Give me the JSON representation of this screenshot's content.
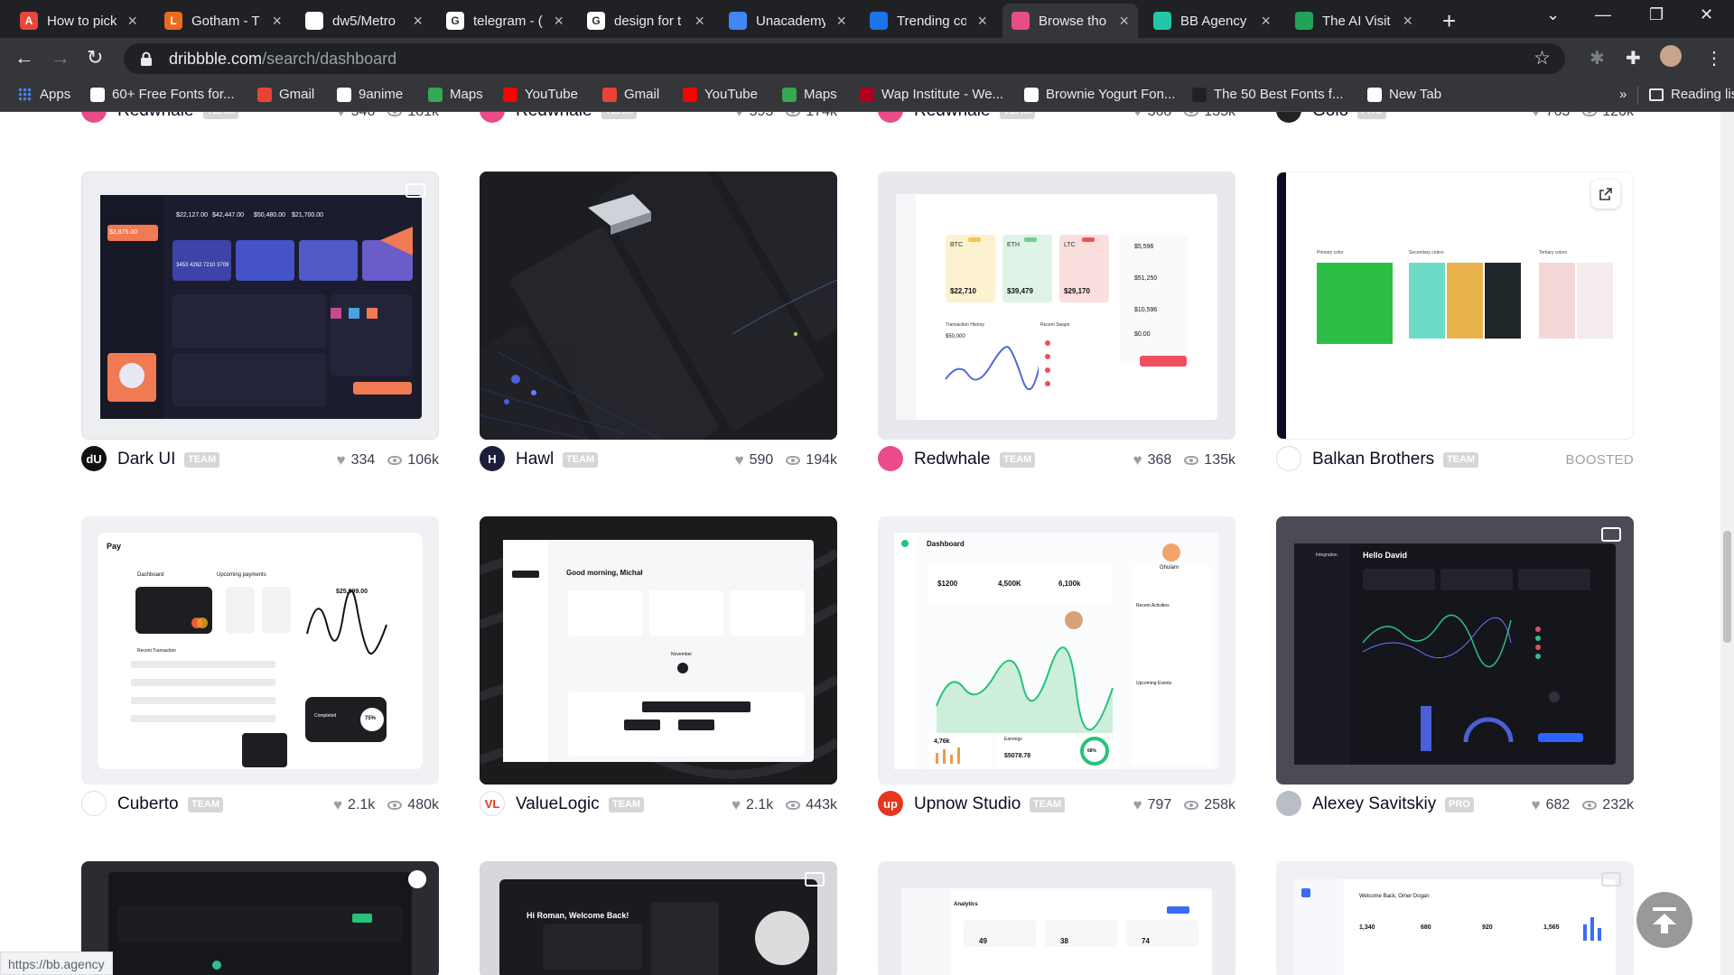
{
  "browser": {
    "tabs": [
      {
        "title": "How to pick",
        "color": "#e8453c",
        "letter": "A",
        "active": false
      },
      {
        "title": "Gotham - T",
        "color": "#e86b1f",
        "letter": "L",
        "active": false
      },
      {
        "title": "dw5/Metro",
        "color": "#ffffff",
        "letter": "",
        "active": false
      },
      {
        "title": "telegram - (",
        "color": "#ffffff",
        "letter": "G",
        "active": false
      },
      {
        "title": "design for t",
        "color": "#ffffff",
        "letter": "G",
        "active": false
      },
      {
        "title": "Unacademy",
        "color": "#4285f4",
        "letter": "",
        "active": false
      },
      {
        "title": "Trending co",
        "color": "#1a73e8",
        "letter": "",
        "active": false
      },
      {
        "title": "Browse tho",
        "color": "#ea4c89",
        "letter": "",
        "active": true
      },
      {
        "title": "BB Agency",
        "color": "#21c8a7",
        "letter": "",
        "active": false
      },
      {
        "title": "The AI Visit",
        "color": "#22a35a",
        "letter": "",
        "active": false
      }
    ],
    "url_domain": "dribbble.com",
    "url_path": "/search/dashboard",
    "bookmarks": [
      {
        "label": "Apps",
        "color": "#4285f4"
      },
      {
        "label": "60+ Free Fonts for...",
        "color": "#ffffff"
      },
      {
        "label": "Gmail",
        "color": "#ea4335"
      },
      {
        "label": "9anime",
        "color": "#ffffff"
      },
      {
        "label": "Maps",
        "color": "#34a853"
      },
      {
        "label": "YouTube",
        "color": "#ff0000"
      },
      {
        "label": "Gmail",
        "color": "#ea4335"
      },
      {
        "label": "YouTube",
        "color": "#ff0000"
      },
      {
        "label": "Maps",
        "color": "#34a853"
      },
      {
        "label": "Wap Institute - We...",
        "color": "#b00020"
      },
      {
        "label": "Brownie Yogurt Fon...",
        "color": "#ffffff"
      },
      {
        "label": "The 50 Best Fonts f...",
        "color": "#202124"
      },
      {
        "label": "New Tab",
        "color": "#ffffff"
      }
    ],
    "more_bookmarks": "»",
    "reading_list": "Reading list",
    "status_url": "https://bb.agency"
  },
  "top_row": [
    {
      "name": "Redwhale",
      "badge": "TEAM",
      "likes": "546",
      "views": "181k",
      "avatar": "#ea4c89"
    },
    {
      "name": "Redwhale",
      "badge": "TEAM",
      "likes": "593",
      "views": "174k",
      "avatar": "#ea4c89"
    },
    {
      "name": "Redwhale",
      "badge": "TEAM",
      "likes": "368",
      "views": "135k",
      "avatar": "#ea4c89"
    },
    {
      "name": "Golo",
      "badge": "PRO",
      "likes": "763",
      "views": "120k",
      "avatar": "#222222"
    }
  ],
  "row1": [
    {
      "name": "Dark UI",
      "badge": "TEAM",
      "likes": "334",
      "views": "106k",
      "avatar": "#111111",
      "avatar_letter": "dU"
    },
    {
      "name": "Hawl",
      "badge": "TEAM",
      "likes": "590",
      "views": "194k",
      "avatar": "#1c1d3a",
      "avatar_letter": "H"
    },
    {
      "name": "Redwhale",
      "badge": "TEAM",
      "likes": "368",
      "views": "135k",
      "avatar": "#ea4c89",
      "avatar_letter": ""
    },
    {
      "name": "Balkan Brothers",
      "badge": "TEAM",
      "boosted": "BOOSTED",
      "avatar": "#ffffff",
      "avatar_letter": ""
    }
  ],
  "row2": [
    {
      "name": "Cuberto",
      "badge": "TEAM",
      "likes": "2.1k",
      "views": "480k",
      "avatar": "#ffffff",
      "avatar_letter": ""
    },
    {
      "name": "ValueLogic",
      "badge": "TEAM",
      "likes": "2.1k",
      "views": "443k",
      "avatar": "#ffffff",
      "avatar_letter": "VL"
    },
    {
      "name": "Upnow Studio",
      "badge": "TEAM",
      "likes": "797",
      "views": "258k",
      "avatar": "#e8351e",
      "avatar_letter": "up"
    },
    {
      "name": "Alexey Savitskiy",
      "badge": "PRO",
      "likes": "682",
      "views": "232k",
      "avatar": "#b9bec6",
      "avatar_letter": ""
    }
  ],
  "shots": {
    "darkui": {
      "balances": [
        "$22,127.00",
        "$42,447.00",
        "$50,480.00",
        "$21,700.00"
      ],
      "big": "$3,875.00",
      "card": "3453 4262 7210 3709"
    },
    "redwhale": {
      "coins": [
        "BTC",
        "ETH",
        "LTC"
      ],
      "values": [
        "$22,710",
        "$39,479",
        "$29,170"
      ],
      "side": [
        "$5,596",
        "$51,250",
        "$10,596",
        "$0.00"
      ],
      "history": "Transaction History",
      "recent": "Recent Swaps",
      "amount": "$50,000"
    },
    "balkan": {
      "labels": [
        "Primary color",
        "Secondary colors",
        "Tertiary colors"
      ],
      "swatches": [
        "#2fbe45",
        "#6cdcc7",
        "#e8b24c",
        "#1f2629",
        "#f3d6d6",
        "#f4ecec"
      ]
    },
    "cuberto": {
      "title": "Pay",
      "dash": "Dashboard",
      "upcoming": "Upcoming payments",
      "amount": "$25,999.00",
      "completed": "Completed",
      "percent": "75%",
      "recent": "Recent Transaction"
    },
    "valuelogic": {
      "greeting": "Good morning, Michał",
      "month": "November"
    },
    "upnow": {
      "title": "Dashboard",
      "values": [
        "$1200",
        "4,500K",
        "6,100k"
      ],
      "order": "4,76k",
      "earnings": "Earnings",
      "earn_value": "$5078.78",
      "ring": "68%",
      "activities": "Recent Activities",
      "events": "Upcoming Events",
      "user": "Ghulam"
    },
    "alexey": {
      "title": "Integration",
      "hello": "Hello David"
    },
    "bottom": {
      "welcome": "Hi Roman, Welcome Back!",
      "analytics": "Analytics",
      "welcome2": "Welcome Back, Omer Dogan",
      "stats": [
        "1,340",
        "680",
        "920",
        "1,565"
      ],
      "a1": "49",
      "a2": "38",
      "a3": "74"
    }
  }
}
